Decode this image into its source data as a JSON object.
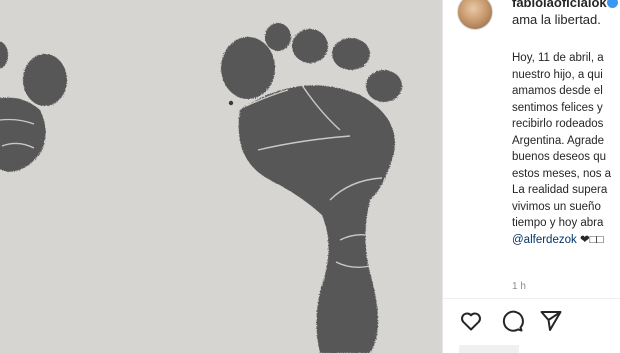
{
  "post": {
    "image_alt": "Baby footprints on paper",
    "author": "fabiolaoficialok",
    "first_line": "ama la libertad.",
    "caption_lines": [
      "Hoy, 11 de abril, a",
      "nuestro hijo, a qui",
      "amamos desde el",
      "sentimos felices y",
      "recibirlo rodeados",
      "Argentina. Agrade",
      "buenos deseos qu",
      "estos meses, nos a",
      "La realidad supera",
      "vivimos un sueño",
      "tiempo y hoy abra"
    ],
    "mention": "@alferdezok",
    "mention_suffix": "❤□□",
    "timestamp": "1 h"
  },
  "actions": {
    "like_icon": "heart-icon",
    "comment_icon": "comment-icon",
    "share_icon": "share-icon"
  },
  "colors": {
    "text": "#262626",
    "mention": "#00376b",
    "muted": "#8e8e8e",
    "verified": "#3897f0",
    "photo_bg": "#d6d4d1",
    "ink": "#4a4a4a"
  }
}
